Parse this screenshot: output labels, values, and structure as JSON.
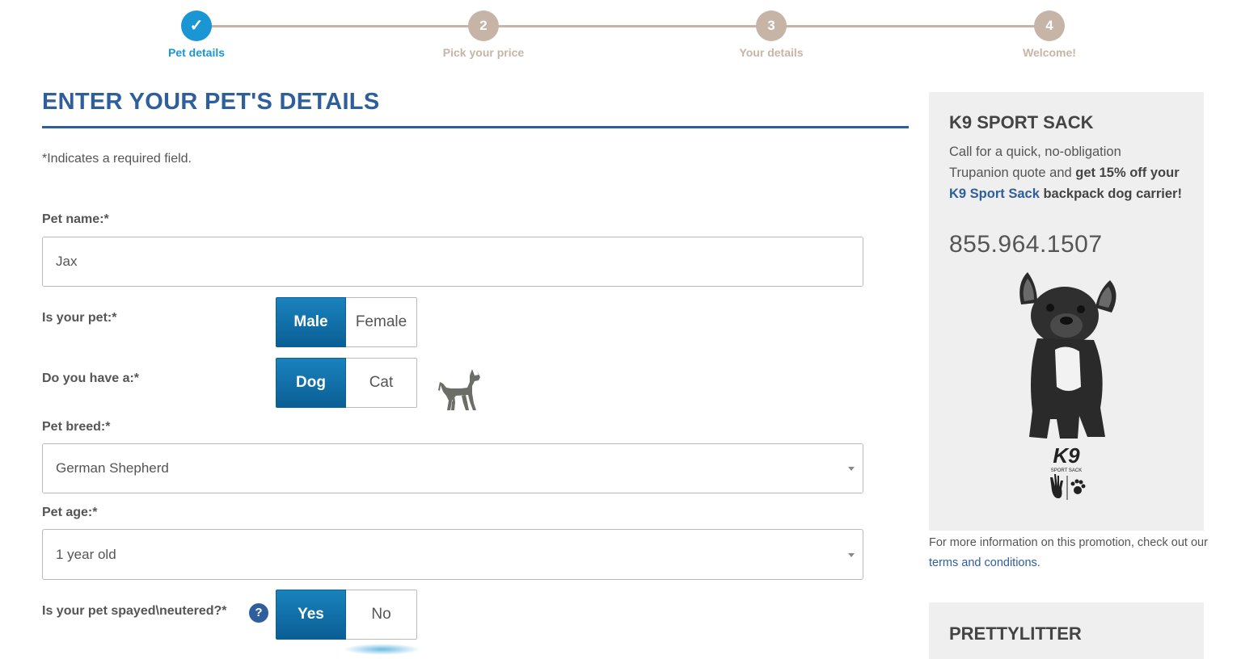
{
  "stepper": {
    "steps": [
      {
        "marker": "✓",
        "label": "Pet details"
      },
      {
        "marker": "2",
        "label": "Pick your price"
      },
      {
        "marker": "3",
        "label": "Your details"
      },
      {
        "marker": "4",
        "label": "Welcome!"
      }
    ],
    "active_step": 1
  },
  "form": {
    "title": "ENTER YOUR PET'S DETAILS",
    "required_note": "*Indicates a required field.",
    "pet_name": {
      "label": "Pet name:*",
      "value": "Jax"
    },
    "sex": {
      "label": "Is your pet:*",
      "options": [
        "Male",
        "Female"
      ],
      "selected": "Male"
    },
    "species": {
      "label": "Do you have a:*",
      "options": [
        "Dog",
        "Cat"
      ],
      "selected": "Dog",
      "icon": "dog-silhouette-icon"
    },
    "breed": {
      "label": "Pet breed:*",
      "value": "German Shepherd"
    },
    "age": {
      "label": "Pet age:*",
      "value": "1 year old"
    },
    "spayed": {
      "label": "Is your pet spayed\\neutered?*",
      "help": "?",
      "options": [
        "Yes",
        "No"
      ],
      "selected": "Yes"
    }
  },
  "sidebar": {
    "promo": {
      "title": "K9 SPORT SACK",
      "text_1": "Call for a quick, no-obligation Trupanion quote and ",
      "text_bold_1": "get 15% off your ",
      "link": "K9 Sport Sack",
      "text_bold_2": " backpack dog carrier!",
      "phone": "855.964.1507",
      "logo_text": "K9",
      "logo_subtext": "SPORT SACK"
    },
    "note_prefix": "For more information on this promotion, check out our ",
    "note_link": "terms and conditions",
    "note_suffix": ".",
    "promo2": {
      "title": "PRETTYLITTER"
    }
  },
  "colors": {
    "primary_blue": "#2e5e9c",
    "active_step": "#1a96d4",
    "inactive_step": "#c6b5a6",
    "toggle_selected": "#0a6fab"
  }
}
